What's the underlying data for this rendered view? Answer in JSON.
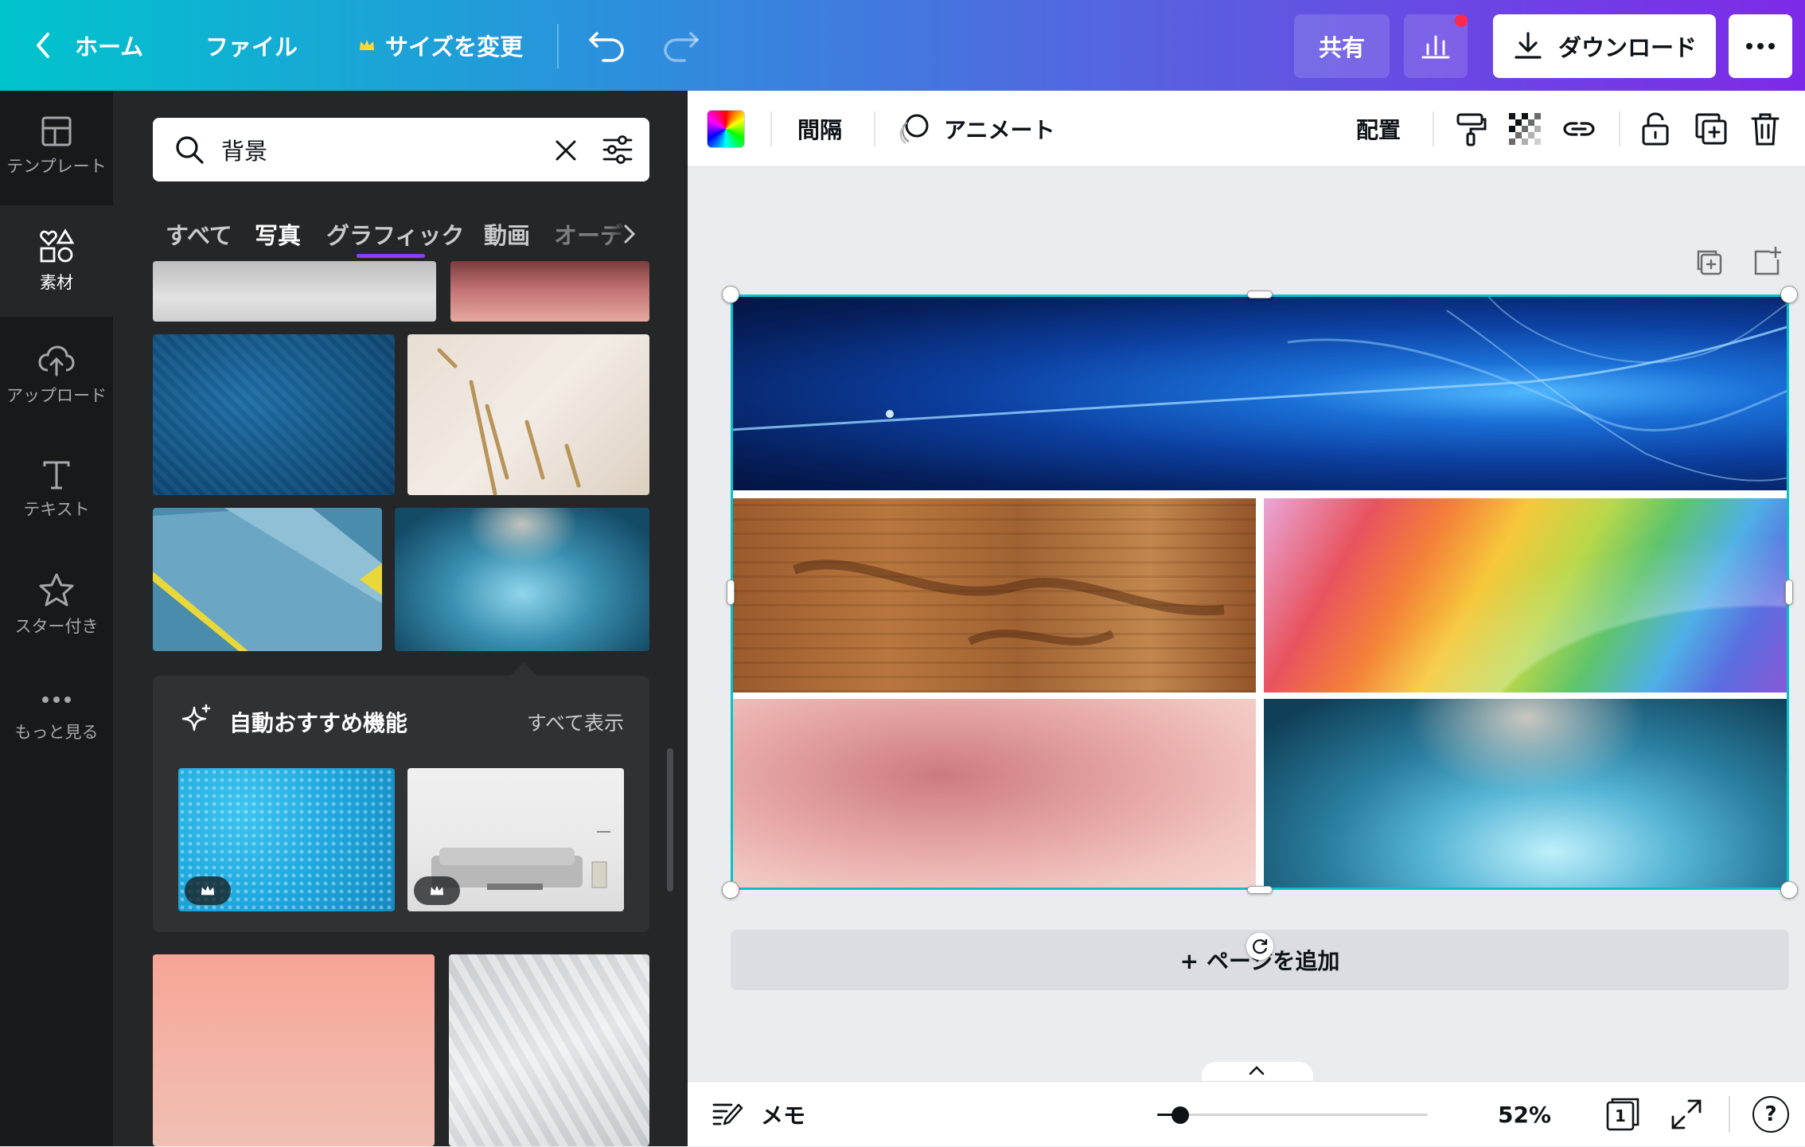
{
  "topbar": {
    "home": "ホーム",
    "file": "ファイル",
    "resize": "サイズを変更",
    "share": "共有",
    "download": "ダウンロード",
    "more_icon": "ellipsis-icon",
    "notification_color": "#ff2a4d"
  },
  "rail": {
    "items": [
      {
        "label": "テンプレート",
        "icon": "template-icon"
      },
      {
        "label": "素材",
        "icon": "elements-icon"
      },
      {
        "label": "アップロード",
        "icon": "cloud-upload-icon"
      },
      {
        "label": "テキスト",
        "icon": "text-icon"
      },
      {
        "label": "スター付き",
        "icon": "star-icon"
      },
      {
        "label": "もっと見る",
        "icon": "more-icon"
      }
    ],
    "active_index": 1
  },
  "panel": {
    "search": {
      "value": "背景",
      "placeholder": ""
    },
    "tabs": [
      "すべて",
      "写真",
      "グラフィック",
      "動画",
      "オーデ"
    ],
    "active_tab": "写真",
    "recommend": {
      "title": "自動おすすめ機能",
      "see_all": "すべて表示"
    }
  },
  "toolbar": {
    "spacing": "間隔",
    "animate": "アニメート",
    "position": "配置"
  },
  "canvas": {
    "add_page": "+ ページを追加",
    "selection_color": "#00c4cc"
  },
  "bottombar": {
    "notes": "メモ",
    "zoom": "52%",
    "zoom_value": 0.52,
    "page_count": "1",
    "help": "?"
  },
  "colors": {
    "accent_purple": "#8b3dff",
    "panel_bg": "#252627",
    "rail_bg": "#18191b"
  }
}
